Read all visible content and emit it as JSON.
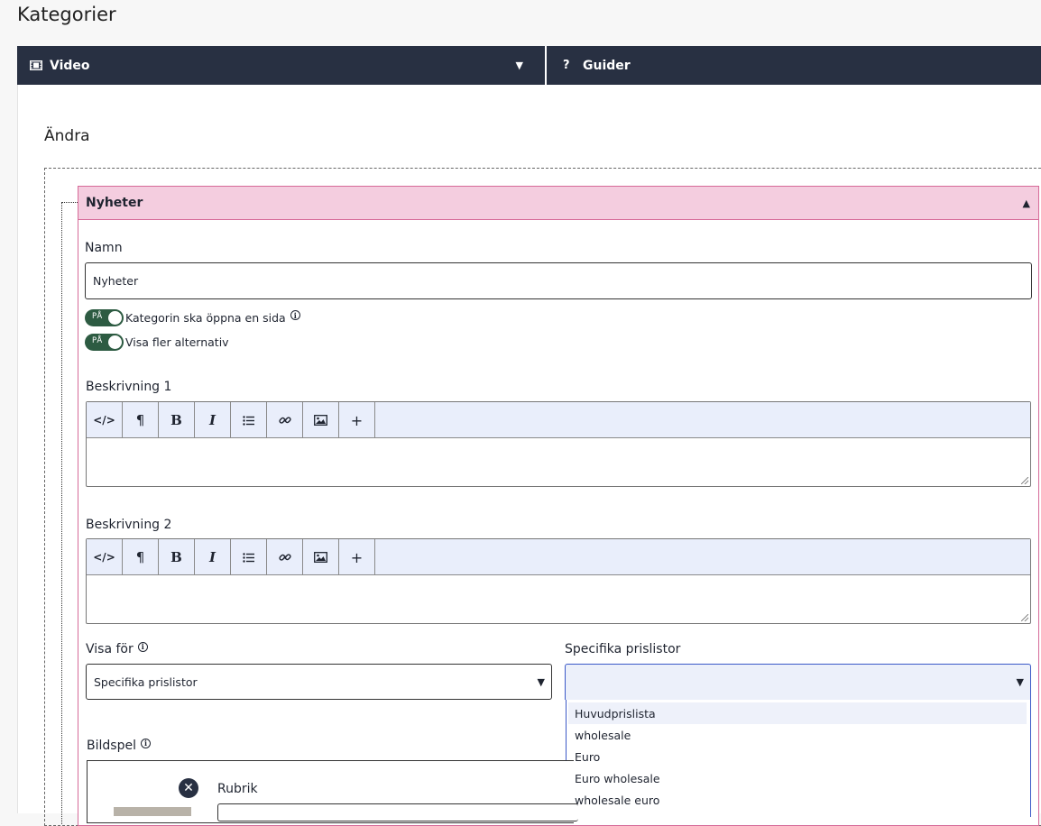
{
  "page": {
    "title": "Kategorier"
  },
  "tabs": {
    "video": "Video",
    "guider": "Guider"
  },
  "section": {
    "heading": "Ändra"
  },
  "category": {
    "header": "Nyheter",
    "name_label": "Namn",
    "name_value": "Nyheter",
    "toggle_on_text": "PÅ",
    "toggle_open_page_label": "Kategorin ska öppna en sida",
    "toggle_more_options_label": "Visa fler alternativ"
  },
  "editors": {
    "desc1_label": "Beskrivning 1",
    "desc2_label": "Beskrivning 2",
    "toolbar_icons": [
      "code-icon",
      "paragraph-icon",
      "bold-icon",
      "italic-icon",
      "list-icon",
      "link-icon",
      "image-icon",
      "plus-icon"
    ]
  },
  "visibility": {
    "visa_for_label": "Visa för",
    "visa_for_value": "Specifika prislistor",
    "pricelists_label": "Specifika prislistor",
    "pricelists_value": "",
    "options": [
      "Huvudprislista",
      "wholesale",
      "Euro",
      "Euro wholesale",
      "wholesale euro"
    ],
    "highlighted_option": "Huvudprislista"
  },
  "slideshow": {
    "label": "Bildspel",
    "rubrik_label": "Rubrik"
  },
  "colors": {
    "tabbar_bg": "#283042",
    "card_header_bg": "#f4cddf",
    "card_border": "#d66a98",
    "toggle_on": "#2d5b42",
    "toolbar_bg": "#e9eefb",
    "select_focus": "#3b59c7"
  }
}
